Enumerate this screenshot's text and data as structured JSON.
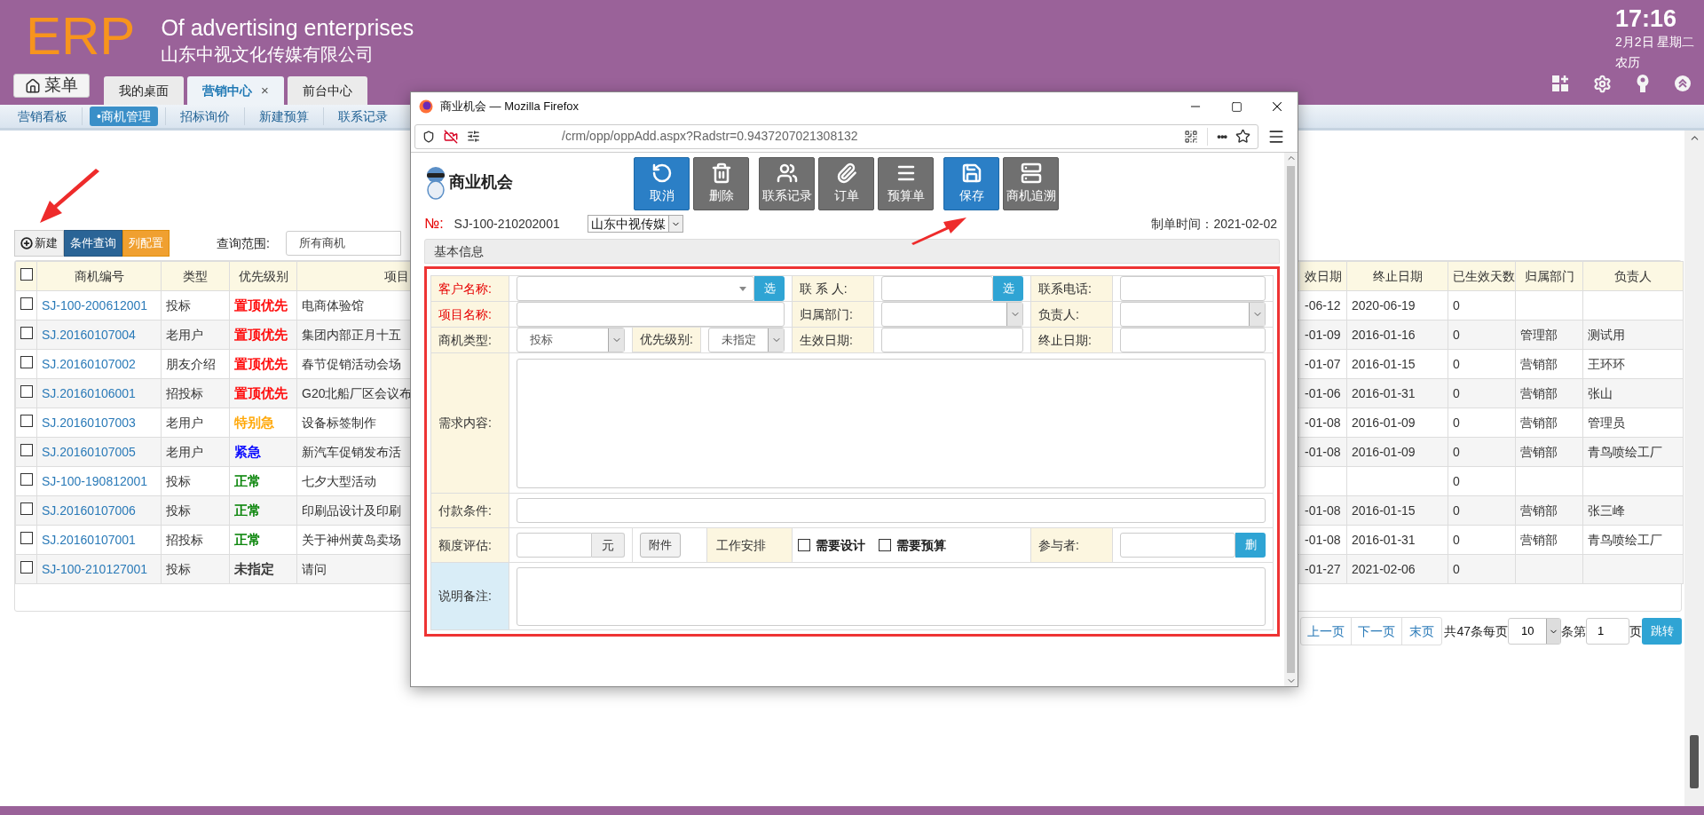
{
  "header": {
    "logo": "ERP",
    "title": "Of advertising enterprises",
    "company": "山东中视文化传媒有限公司",
    "time": "17:16",
    "date": "2月2日 星期二",
    "lunar": "农历"
  },
  "menu_button": "菜单",
  "tabs": [
    {
      "label": "我的桌面",
      "selected": false
    },
    {
      "label": "营销中心",
      "selected": true,
      "close": "×"
    },
    {
      "label": "前台中心",
      "selected": false
    }
  ],
  "subnav": [
    {
      "label": "营销看板",
      "selected": false
    },
    {
      "label": "•商机管理",
      "selected": true
    },
    {
      "label": "招标询价",
      "selected": false
    },
    {
      "label": "新建预算",
      "selected": false
    },
    {
      "label": "联系记录",
      "selected": false
    }
  ],
  "toolbar": {
    "buttons": [
      {
        "label": "新建",
        "kind": "new"
      },
      {
        "label": "条件查询",
        "kind": "query"
      },
      {
        "label": "列配置",
        "kind": "config"
      }
    ],
    "scope_label": "查询范围:",
    "scope_value": "所有商机"
  },
  "table": {
    "all_checked": false,
    "columns": [
      "商机编号",
      "类型",
      "优先级别",
      "项目",
      "效日期",
      "终止日期",
      "已生效天数",
      "归属部门",
      "负责人"
    ],
    "rows": [
      {
        "checked": false,
        "code": "SJ-100-200612001",
        "type": "投标",
        "priority": "置顶优先",
        "color": "#ff0000",
        "project": "电商体验馆",
        "start": "-06-12",
        "end": "2020-06-19",
        "days": "0"
      },
      {
        "checked": false,
        "code": "SJ.20160107004",
        "type": "老用户",
        "priority": "置顶优先",
        "color": "#ff0000",
        "project": "集团内部正月十五",
        "start": "-01-09",
        "end": "2016-01-16",
        "days": "0",
        "dept": "管理部",
        "owner": "测试用"
      },
      {
        "checked": false,
        "code": "SJ.20160107002",
        "type": "朋友介绍",
        "priority": "置顶优先",
        "color": "#ff0000",
        "project": "春节促销活动会场",
        "start": "-01-07",
        "end": "2016-01-15",
        "days": "0",
        "dept": "营销部",
        "owner": "王环环"
      },
      {
        "checked": false,
        "code": "SJ.20160106001",
        "type": "招投标",
        "priority": "置顶优先",
        "color": "#ff0000",
        "project": "G20北船厂区会议布",
        "start": "-01-06",
        "end": "2016-01-31",
        "days": "0",
        "dept": "营销部",
        "owner": "张山"
      },
      {
        "checked": false,
        "code": "SJ.20160107003",
        "type": "老用户",
        "priority": "特别急",
        "color": "#ffa500",
        "project": "设备标签制作",
        "start": "-01-08",
        "end": "2016-01-09",
        "days": "0",
        "dept": "营销部",
        "owner": "管理员"
      },
      {
        "checked": false,
        "code": "SJ.20160107005",
        "type": "老用户",
        "priority": "紧急",
        "color": "#0000ff",
        "project": "新汽车促销发布活",
        "start": "-01-08",
        "end": "2016-01-09",
        "days": "0",
        "dept": "营销部",
        "owner": "青鸟喷绘工厂"
      },
      {
        "checked": false,
        "code": "SJ-100-190812001",
        "type": "投标",
        "priority": "正常",
        "color": "#008000",
        "project": "七夕大型活动",
        "days": "0"
      },
      {
        "checked": false,
        "code": "SJ.20160107006",
        "type": "投标",
        "priority": "正常",
        "color": "#008000",
        "project": "印刷品设计及印刷",
        "start": "-01-08",
        "end": "2016-01-15",
        "days": "0",
        "dept": "营销部",
        "owner": "张三峰"
      },
      {
        "checked": false,
        "code": "SJ.20160107001",
        "type": "招投标",
        "priority": "正常",
        "color": "#008000",
        "project": "关于神州黄岛卖场",
        "start": "-01-08",
        "end": "2016-01-31",
        "days": "0",
        "dept": "营销部",
        "owner": "青鸟喷绘工厂"
      },
      {
        "checked": false,
        "code": "SJ-100-210127001",
        "type": "投标",
        "priority": "未指定",
        "color": "#333333",
        "project": "请问",
        "start": "-01-27",
        "end": "2021-02-06",
        "days": "0"
      }
    ]
  },
  "pagination": {
    "prev": "上一页",
    "next": "下一页",
    "last": "末页",
    "total": "共47条每页",
    "page_size": "10",
    "items_label": "条第",
    "page": "1",
    "page_label": "页",
    "go": "跳转"
  },
  "dialog": {
    "title": "商业机会 — Mozilla Firefox",
    "url": "/crm/opp/oppAdd.aspx?Radstr=0.9437207021308132",
    "more": "•••",
    "heading": "商业机会",
    "action_groups": [
      [
        {
          "label": "取消",
          "kind": "undo",
          "primary": true
        },
        {
          "label": "删除",
          "kind": "delete",
          "primary": false
        }
      ],
      [
        {
          "label": "联系记录",
          "kind": "contacts",
          "primary": false
        },
        {
          "label": "订单",
          "kind": "order",
          "primary": false
        },
        {
          "label": "预算单",
          "kind": "budget",
          "primary": false
        }
      ],
      [
        {
          "label": "保存",
          "kind": "save",
          "primary": true
        },
        {
          "label": "商机追溯",
          "kind": "trace",
          "primary": false
        }
      ]
    ],
    "number_label": "№:",
    "number": "SJ-100-210202001",
    "company_select": "山东中视传媒",
    "created_label": "制单时间：",
    "created": "2021-02-02",
    "section": "基本信息",
    "form": {
      "customer": {
        "label": "客户名称:",
        "required": true,
        "pick": "选"
      },
      "contact": {
        "label": "联 系 人:",
        "required": false,
        "pick": "选"
      },
      "phone": {
        "label": "联系电话:",
        "required": false
      },
      "project": {
        "label": "项目名称:",
        "required": true
      },
      "dept": {
        "label": "归属部门:",
        "required": false
      },
      "owner": {
        "label": "负责人:",
        "required": false
      },
      "opp_type": {
        "label": "商机类型:",
        "required": false,
        "value": "投标"
      },
      "priority": {
        "label": "优先级别:",
        "required": false,
        "value": "未指定"
      },
      "start": {
        "label": "生效日期:",
        "required": false
      },
      "end": {
        "label": "终止日期:",
        "required": false
      },
      "needs": {
        "label": "需求内容:",
        "required": false
      },
      "payment": {
        "label": "付款条件:",
        "required": false
      },
      "amount": {
        "label": "额度评估:",
        "required": false,
        "unit": "元"
      },
      "attach": "附件",
      "work_label": "工作安排",
      "tasks": [
        {
          "label": "需要设计",
          "checked": false
        },
        {
          "label": "需要预算",
          "checked": false
        }
      ],
      "participants": {
        "label": "参与者:",
        "required": false,
        "action": "删"
      },
      "remarks": {
        "label": "说明备注:",
        "required": false
      }
    }
  }
}
